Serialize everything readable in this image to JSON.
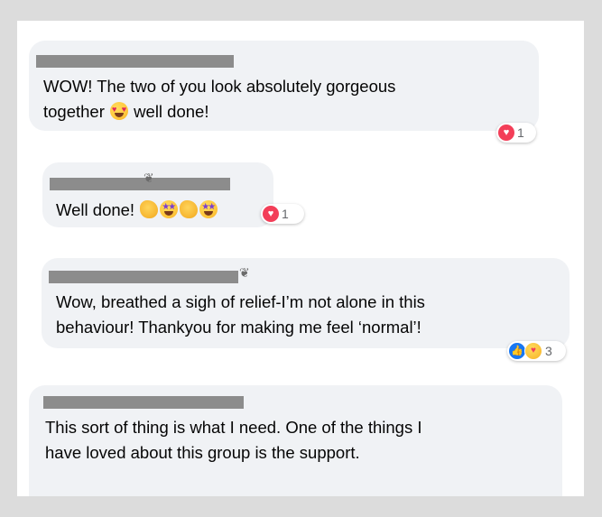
{
  "comments": [
    {
      "lines": [
        "WOW! The two of you look absolutely gorgeous",
        "together",
        "well done!"
      ],
      "emojis": [
        "heart-eyes"
      ],
      "reaction": {
        "icons": [
          "love-icon"
        ],
        "count": "1"
      }
    },
    {
      "lines": [
        "Well done!"
      ],
      "emojis": [
        "clapping-hands",
        "star-struck",
        "clapping-hands",
        "star-struck"
      ],
      "reaction": {
        "icons": [
          "love-icon"
        ],
        "count": "1"
      }
    },
    {
      "lines": [
        "Wow, breathed a sigh of relief-I’m not alone in this",
        "behaviour! Thankyou for making me feel ‘normal’!"
      ],
      "reaction": {
        "icons": [
          "like-icon",
          "care-icon"
        ],
        "count": "3"
      }
    },
    {
      "lines": [
        "This sort of thing is what I need. One of the things I",
        "have loved about this group is the support."
      ]
    }
  ],
  "colors": {
    "bubble": "#f0f2f5",
    "love": "#f33e58",
    "like": "#1877f2",
    "redaction": "#8c8c8c"
  }
}
